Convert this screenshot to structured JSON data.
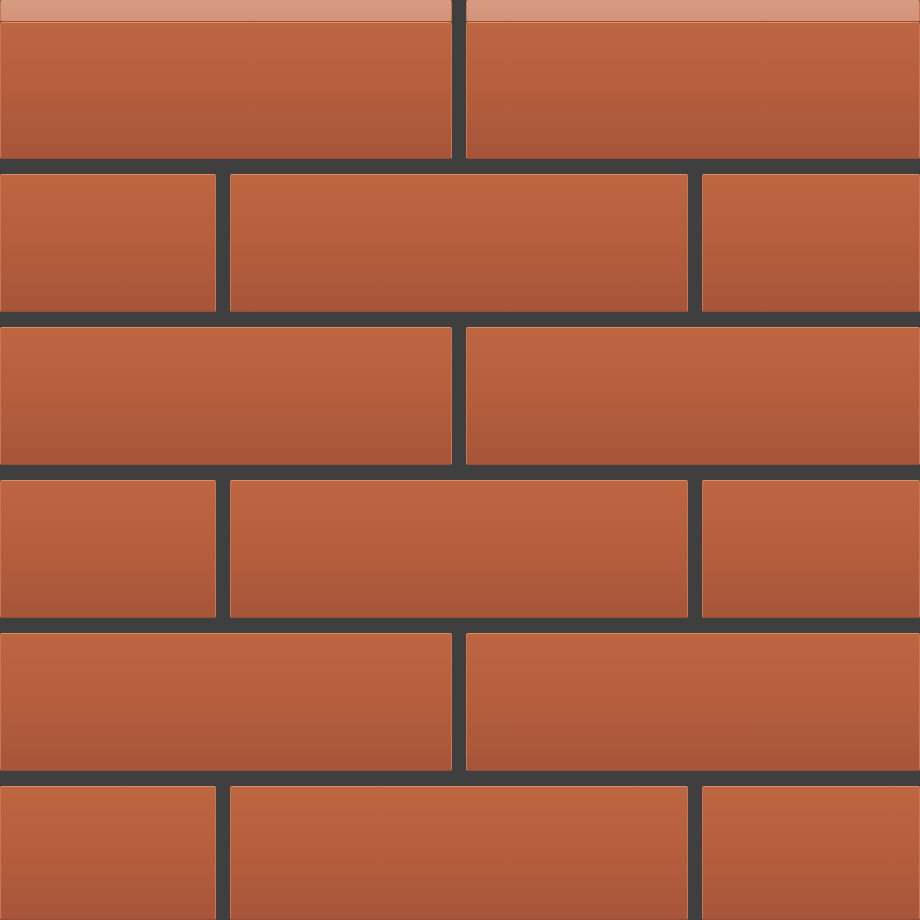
{
  "scene": "brick-wall",
  "colors": {
    "mortar": "#3f3f3f",
    "brick_top": "#bd6640",
    "brick_bottom": "#a6553a",
    "highlight": "#d98d6a",
    "cap": "#d59b81"
  },
  "rows": 6,
  "pattern": "running-bond"
}
